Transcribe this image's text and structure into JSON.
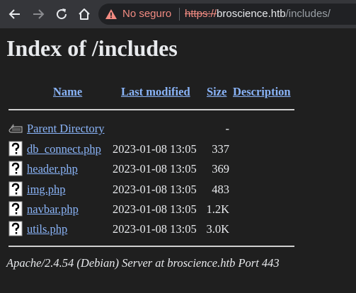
{
  "browser": {
    "security_label": "No seguro",
    "url_scheme": "https://",
    "url_host": "broscience.htb",
    "url_path": "/includes/"
  },
  "page": {
    "title": "Index of /includes",
    "columns": {
      "name": "Name",
      "last_modified": "Last modified",
      "size": "Size",
      "description": "Description"
    },
    "parent": {
      "name": "Parent Directory",
      "date": "",
      "size": "-"
    },
    "files": [
      {
        "name": "db_connect.php",
        "date": "2023-01-08 13:05",
        "size": "337"
      },
      {
        "name": "header.php",
        "date": "2023-01-08 13:05",
        "size": "369"
      },
      {
        "name": "img.php",
        "date": "2023-01-08 13:05",
        "size": "483"
      },
      {
        "name": "navbar.php",
        "date": "2023-01-08 13:05",
        "size": "1.2K"
      },
      {
        "name": "utils.php",
        "date": "2023-01-08 13:05",
        "size": "3.0K"
      }
    ],
    "footer": "Apache/2.4.54 (Debian) Server at broscience.htb Port 443"
  }
}
